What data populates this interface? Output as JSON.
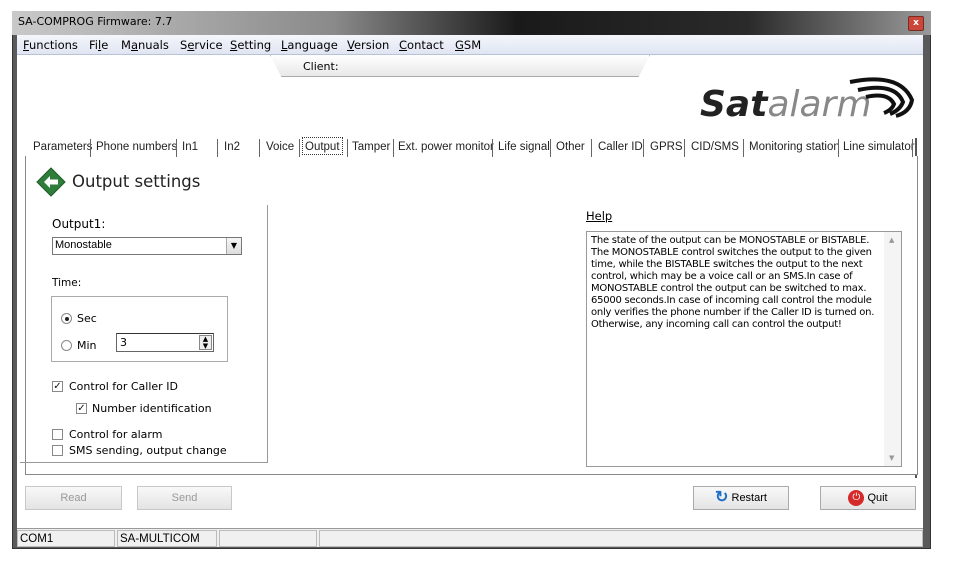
{
  "window": {
    "title": "SA-COMPROG Firmware: 7.7",
    "close_icon": "close-icon"
  },
  "menu": [
    {
      "pre": "",
      "u": "F",
      "post": "unctions"
    },
    {
      "pre": "Fi",
      "u": "l",
      "post": "e"
    },
    {
      "pre": "M",
      "u": "a",
      "post": "nuals"
    },
    {
      "pre": "S",
      "u": "e",
      "post": "rvice"
    },
    {
      "pre": "",
      "u": "S",
      "post": "etting"
    },
    {
      "pre": "",
      "u": "L",
      "post": "anguage"
    },
    {
      "pre": "",
      "u": "V",
      "post": "ersion"
    },
    {
      "pre": "",
      "u": "C",
      "post": "ontact"
    },
    {
      "pre": "",
      "u": "G",
      "post": "SM"
    }
  ],
  "client_label": "Client:",
  "logo_text": "Satalarm",
  "tabs": [
    "Parameters",
    "Phone numbers",
    "In1",
    "In2",
    "Voice",
    "Output",
    "Tamper",
    "Ext. power monitor",
    "Life signal",
    "Other",
    "Caller ID",
    "GPRS",
    "CID/SMS",
    "Monitoring station",
    "Line simulator"
  ],
  "active_tab": "Output",
  "page": {
    "title": "Output settings",
    "back_icon": "green-arrow-left-icon"
  },
  "output": {
    "label": "Output1:",
    "mode": "Monostable",
    "time_label": "Time:",
    "unit_sec": "Sec",
    "unit_min": "Min",
    "selected_unit": "Sec",
    "time_value": "3",
    "checkboxes": [
      {
        "label": "Control for Caller ID",
        "checked": true
      },
      {
        "label": "Number identification",
        "checked": true
      },
      {
        "label": "Control for alarm",
        "checked": false
      },
      {
        "label": "SMS sending, output change",
        "checked": false
      }
    ]
  },
  "help": {
    "label": "Help",
    "text": "The state of the output can be MONOSTABLE or BISTABLE. The MONOSTABLE control switches the output to the given time, while the BISTABLE switches the output to the next control, which may be a voice call or an SMS.In case of MONOSTABLE control the output can be switched to max. 65000 seconds.In case of incoming call control the module only verifies the phone number if the Caller ID is turned on. Otherwise, any incoming call can control the output!"
  },
  "buttons": {
    "read": "Read",
    "send": "Send",
    "restart": "Restart",
    "quit": "Quit"
  },
  "status": [
    "COM1",
    "SA-MULTICOM",
    "",
    ""
  ]
}
